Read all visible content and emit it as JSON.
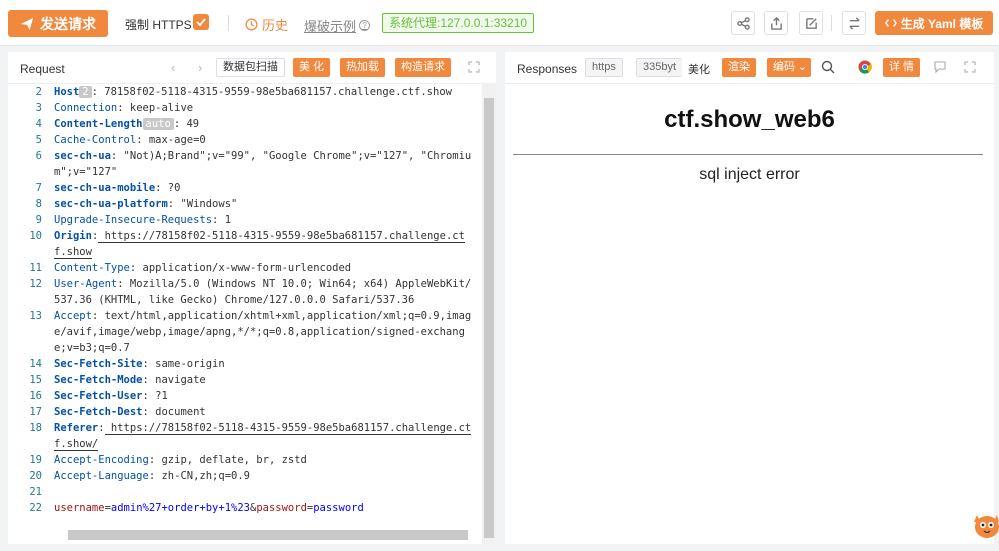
{
  "topbar": {
    "send_label": "发送请求",
    "force_https_label": "强制 HTTPS",
    "force_https_checked": true,
    "history_label": "历史",
    "bypass_label": "爆破示例",
    "proxy_label": "系统代理:127.0.0.1:33210",
    "yaml_label": "生成 Yaml 模板"
  },
  "request": {
    "title": "Request",
    "scan_label": "数据包扫描",
    "beautify_label": "美 化",
    "hotload_label": "热加载",
    "construct_label": "构造请求",
    "lines": [
      {
        "n": "2",
        "key": "Host",
        "tag": "2",
        "val": " 78158f02-5118-4315-9559-98e5ba681157.challenge.ctf.show"
      },
      {
        "n": "3",
        "key": "Connection",
        "val": " keep-alive"
      },
      {
        "n": "4",
        "key": "Content-Length",
        "tag": "auto",
        "val": " 49"
      },
      {
        "n": "5",
        "key": "Cache-Control",
        "val": " max-age=0"
      },
      {
        "n": "6",
        "key": "sec-ch-ua",
        "val": " \"Not)A;Brand\";v=\"99\", \"Google Chrome\";v=\"127\", \"Chromium\";v=\"127\""
      },
      {
        "n": "7",
        "key": "sec-ch-ua-mobile",
        "val": " ?0"
      },
      {
        "n": "8",
        "key": "sec-ch-ua-platform",
        "val": " \"Windows\""
      },
      {
        "n": "9",
        "key": "Upgrade-Insecure-Requests",
        "val": " 1"
      },
      {
        "n": "10",
        "key": "Origin",
        "val": " https://78158f02-5118-4315-9559-98e5ba681157.challenge.ctf.show"
      },
      {
        "n": "11",
        "key": "Content-Type",
        "val": " application/x-www-form-urlencoded"
      },
      {
        "n": "12",
        "key": "User-Agent",
        "val": " Mozilla/5.0 (Windows NT 10.0; Win64; x64) AppleWebKit/537.36 (KHTML, like Gecko) Chrome/127.0.0.0 Safari/537.36"
      },
      {
        "n": "13",
        "key": "Accept",
        "val": " text/html,application/xhtml+xml,application/xml;q=0.9,image/avif,image/webp,image/apng,*/*;q=0.8,application/signed-exchange;v=b3;q=0.7"
      },
      {
        "n": "14",
        "key": "Sec-Fetch-Site",
        "val": " same-origin"
      },
      {
        "n": "15",
        "key": "Sec-Fetch-Mode",
        "val": " navigate"
      },
      {
        "n": "16",
        "key": "Sec-Fetch-User",
        "val": " ?1"
      },
      {
        "n": "17",
        "key": "Sec-Fetch-Dest",
        "val": " document"
      },
      {
        "n": "18",
        "key": "Referer",
        "val": " https://78158f02-5118-4315-9559-98e5ba681157.challenge.ctf.show/"
      },
      {
        "n": "19",
        "key": "Accept-Encoding",
        "val": " gzip, deflate, br, zstd"
      },
      {
        "n": "20",
        "key": "Accept-Language",
        "val": " zh-CN,zh;q=0.9"
      },
      {
        "n": "21",
        "key": "",
        "val": ""
      }
    ],
    "body_line": {
      "n": "22",
      "k1": "username",
      "v1": "admin%27+order+by+1%23",
      "amp": "&",
      "k2": "password",
      "v2": "password"
    }
  },
  "response": {
    "title": "Responses",
    "protocol": "https",
    "size": "335byt",
    "beautify_label": "美化",
    "render_label": "渲染",
    "encoding_label": "编码",
    "details_label": "详 情",
    "page_title": "ctf.show_web6",
    "message": "sql inject error"
  },
  "colors": {
    "accent": "#f0883e",
    "proxy_green": "#67c23a",
    "header_key": "#0451a5",
    "line_number": "#237893"
  }
}
